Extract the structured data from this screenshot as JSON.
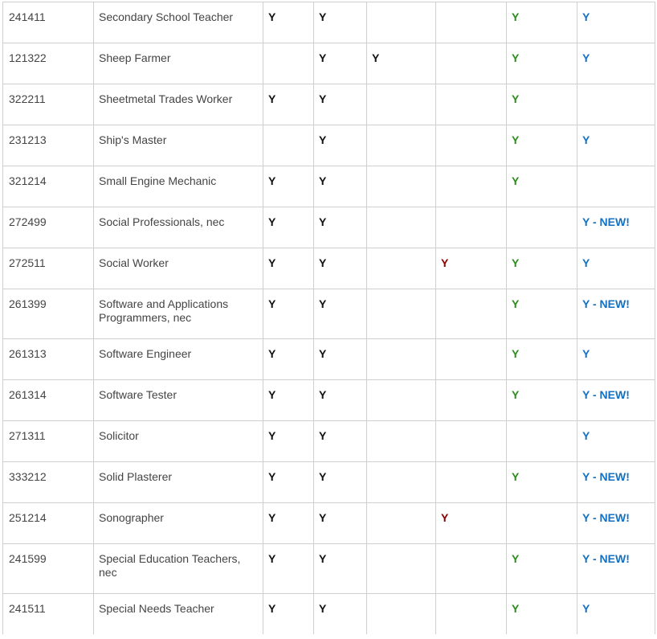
{
  "colors": {
    "text": "#444444",
    "border": "#cfcfcf",
    "mark_black": "#111111",
    "mark_red": "#8b0000",
    "mark_green": "#2e8b1e",
    "mark_blue": "#1570c0"
  },
  "rows": [
    {
      "code": "241411",
      "name": "Secondary School Teacher",
      "c1": "Y",
      "c2": "Y",
      "c3": "",
      "c4": "",
      "c5": "Y",
      "c6": "Y"
    },
    {
      "code": "121322",
      "name": "Sheep Farmer",
      "c1": "",
      "c2": "Y",
      "c3": "Y",
      "c4": "",
      "c5": "Y",
      "c6": "Y"
    },
    {
      "code": "322211",
      "name": "Sheetmetal Trades Worker",
      "c1": "Y",
      "c2": "Y",
      "c3": "",
      "c4": "",
      "c5": "Y",
      "c6": ""
    },
    {
      "code": "231213",
      "name": "Ship's Master",
      "c1": "",
      "c2": "Y",
      "c3": "",
      "c4": "",
      "c5": "Y",
      "c6": "Y"
    },
    {
      "code": "321214",
      "name": "Small Engine Mechanic",
      "c1": "Y",
      "c2": "Y",
      "c3": "",
      "c4": "",
      "c5": "Y",
      "c6": ""
    },
    {
      "code": "272499",
      "name": "Social Professionals, nec",
      "c1": "Y",
      "c2": "Y",
      "c3": "",
      "c4": "",
      "c5": "",
      "c6": "Y - NEW!"
    },
    {
      "code": "272511",
      "name": "Social Worker",
      "c1": "Y",
      "c2": "Y",
      "c3": "",
      "c4": "Y",
      "c5": "Y",
      "c6": "Y"
    },
    {
      "code": "261399",
      "name": "Software and Applications Programmers, nec",
      "c1": "Y",
      "c2": "Y",
      "c3": "",
      "c4": "",
      "c5": "Y",
      "c6": "Y - NEW!"
    },
    {
      "code": "261313",
      "name": "Software Engineer",
      "c1": "Y",
      "c2": "Y",
      "c3": "",
      "c4": "",
      "c5": "Y",
      "c6": "Y"
    },
    {
      "code": "261314",
      "name": "Software Tester",
      "c1": "Y",
      "c2": "Y",
      "c3": "",
      "c4": "",
      "c5": "Y",
      "c6": "Y - NEW!"
    },
    {
      "code": "271311",
      "name": "Solicitor",
      "c1": "Y",
      "c2": "Y",
      "c3": "",
      "c4": "",
      "c5": "",
      "c6": "Y"
    },
    {
      "code": "333212",
      "name": "Solid Plasterer",
      "c1": "Y",
      "c2": "Y",
      "c3": "",
      "c4": "",
      "c5": "Y",
      "c6": "Y - NEW!"
    },
    {
      "code": "251214",
      "name": "Sonographer",
      "c1": "Y",
      "c2": "Y",
      "c3": "",
      "c4": "Y",
      "c5": "",
      "c6": "Y - NEW!"
    },
    {
      "code": "241599",
      "name": "Special Education Teachers, nec",
      "c1": "Y",
      "c2": "Y",
      "c3": "",
      "c4": "",
      "c5": "Y",
      "c6": "Y - NEW!"
    },
    {
      "code": "241511",
      "name": "Special Needs Teacher",
      "c1": "Y",
      "c2": "Y",
      "c3": "",
      "c4": "",
      "c5": "Y",
      "c6": "Y"
    }
  ]
}
